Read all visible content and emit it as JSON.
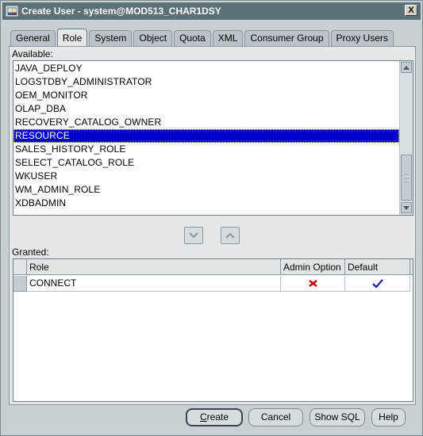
{
  "window": {
    "title": "Create User - system@MOD513_CHAR1DSY",
    "close_label": "X"
  },
  "tabs": [
    {
      "label": "General"
    },
    {
      "label": "Role"
    },
    {
      "label": "System"
    },
    {
      "label": "Object"
    },
    {
      "label": "Quota"
    },
    {
      "label": "XML"
    },
    {
      "label": "Consumer Group"
    },
    {
      "label": "Proxy Users"
    }
  ],
  "active_tab": "Role",
  "available": {
    "label": "Available:",
    "items": [
      "JAVA_DEPLOY",
      "LOGSTDBY_ADMINISTRATOR",
      "OEM_MONITOR",
      "OLAP_DBA",
      "RECOVERY_CATALOG_OWNER",
      "RESOURCE",
      "SALES_HISTORY_ROLE",
      "SELECT_CATALOG_ROLE",
      "WKUSER",
      "WM_ADMIN_ROLE",
      "XDBADMIN"
    ],
    "selected": "RESOURCE"
  },
  "granted": {
    "label": "Granted:",
    "columns": [
      "Role",
      "Admin Option",
      "Default"
    ],
    "rows": [
      {
        "role": "CONNECT",
        "admin_option": "no",
        "default": "yes"
      }
    ]
  },
  "buttons": {
    "create": {
      "mnemonic": "C",
      "rest": "reate"
    },
    "cancel": "Cancel",
    "show_sql": "Show SQL",
    "help": "Help"
  },
  "colors": {
    "title_bar": "#5c7077",
    "selection": "#0000cc",
    "cross": "#cc0000",
    "check": "#1a1aa0"
  }
}
